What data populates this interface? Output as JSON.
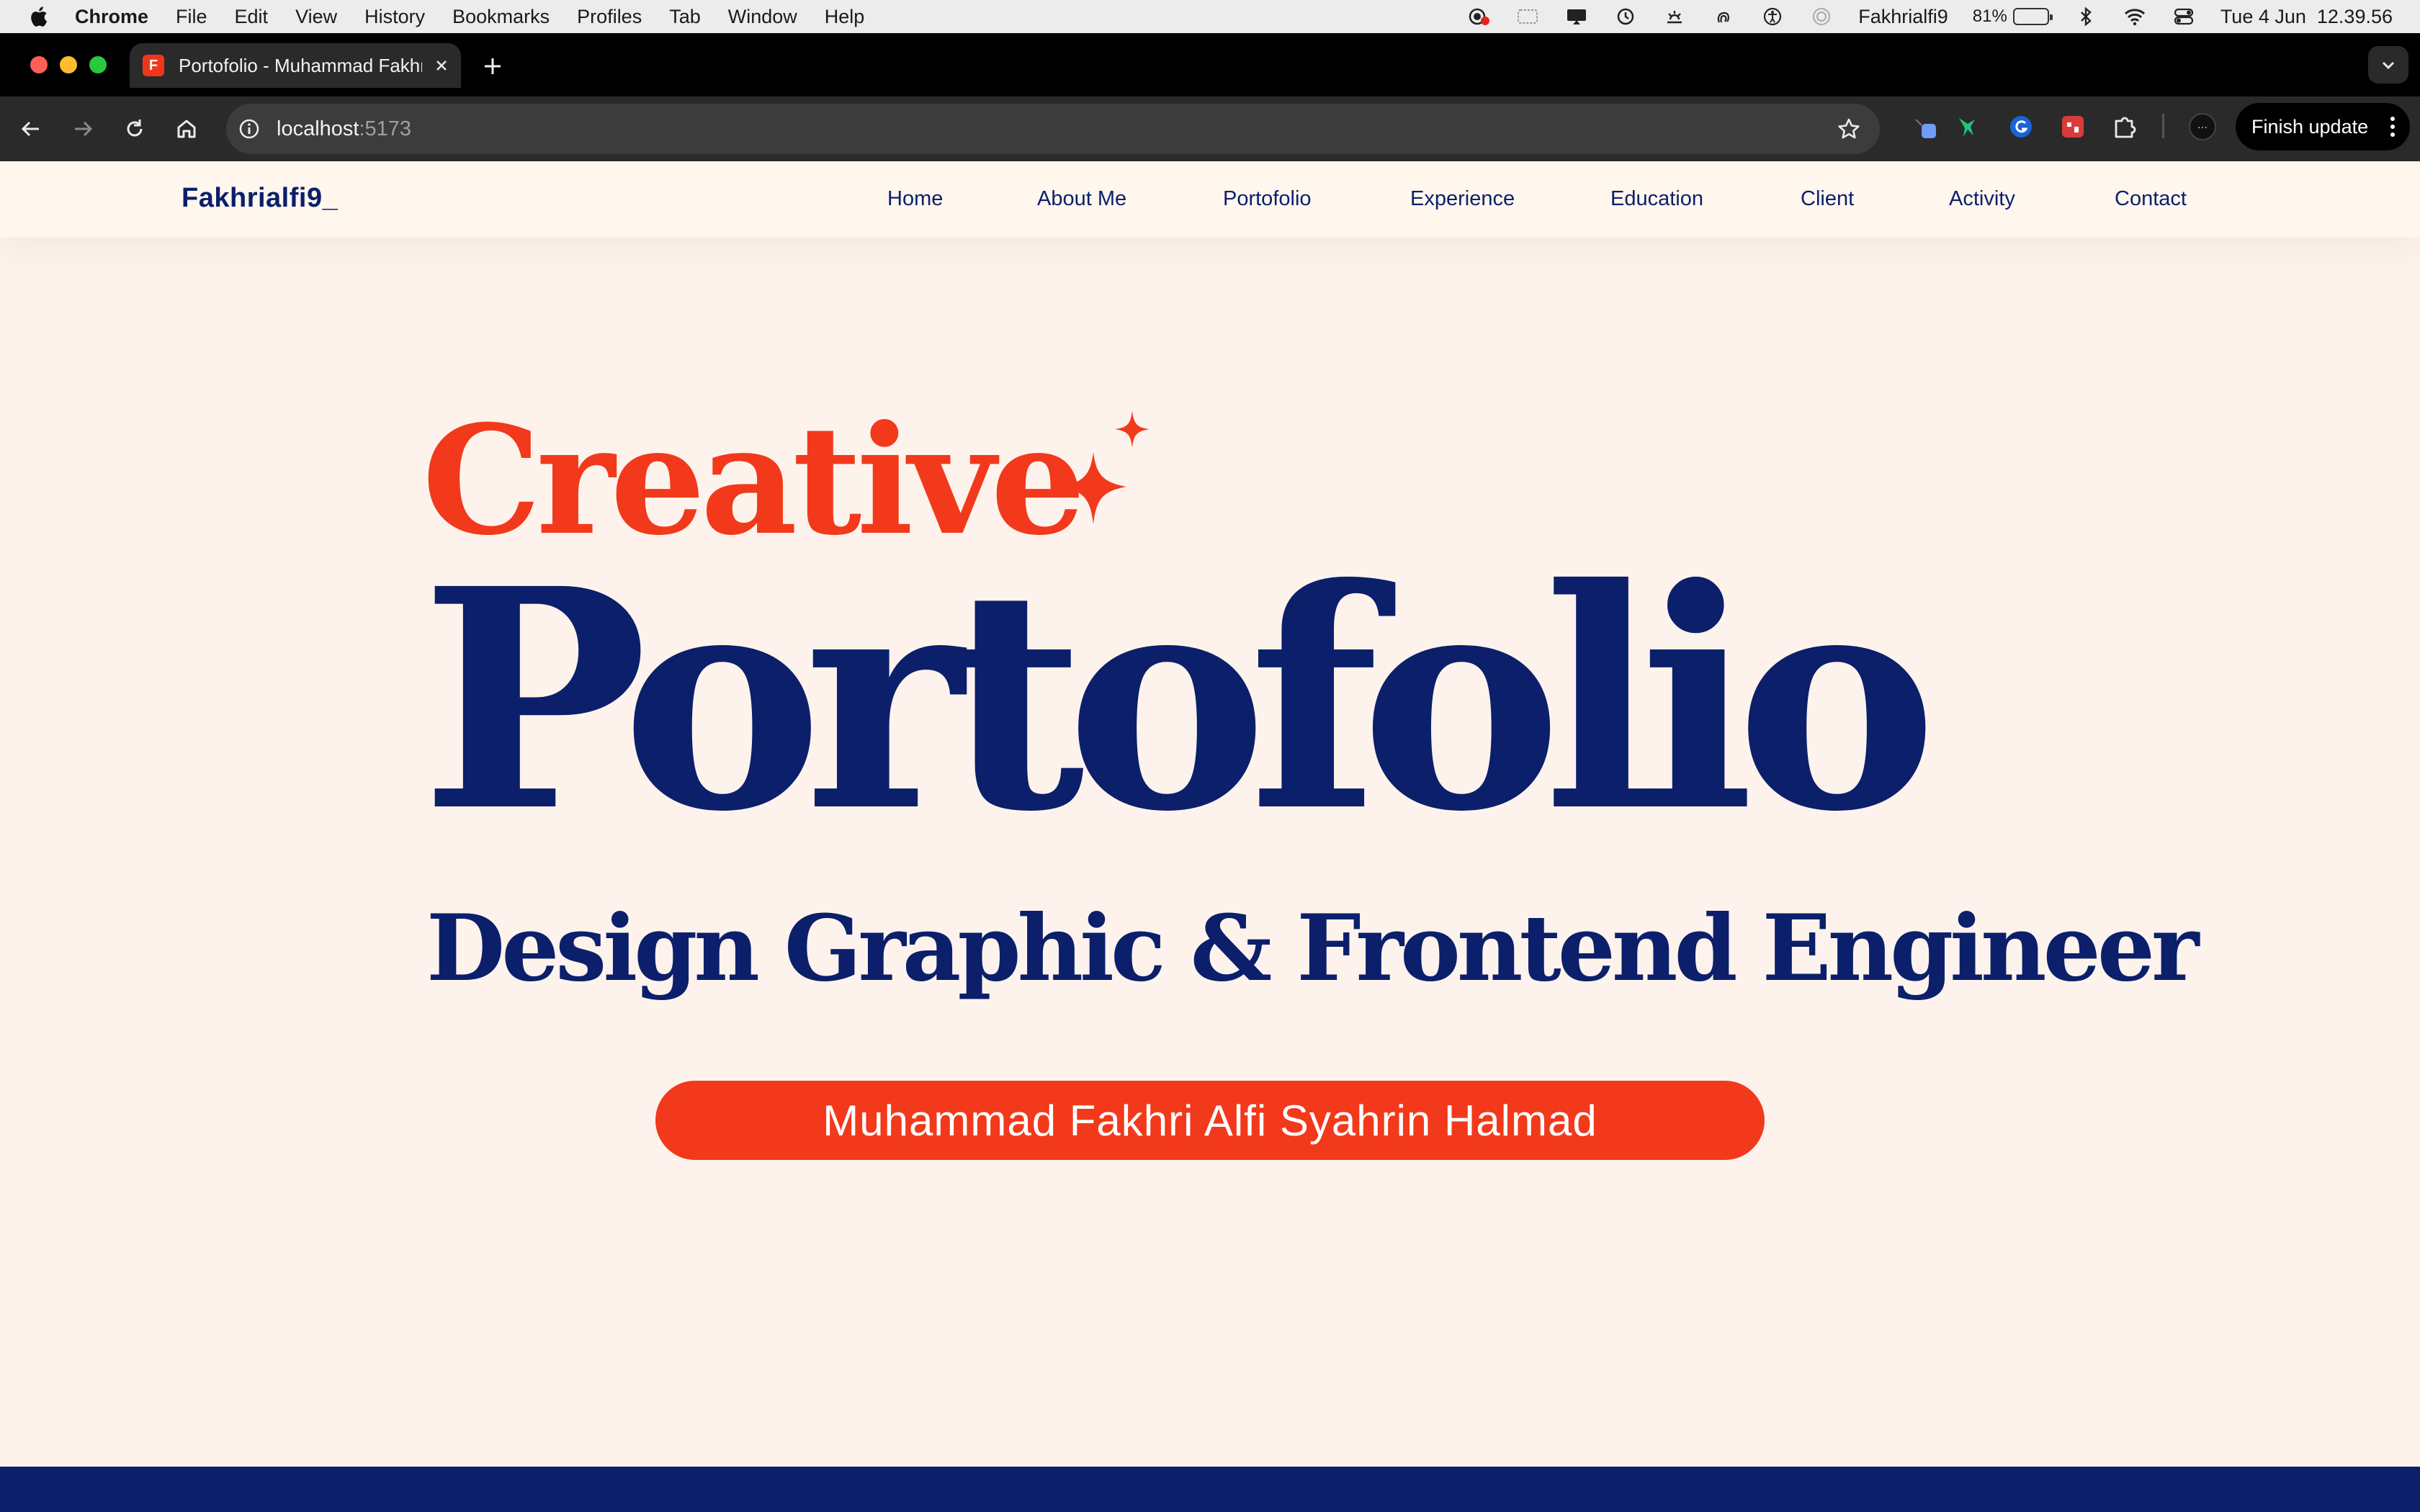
{
  "menubar": {
    "app_name": "Chrome",
    "items": [
      "File",
      "Edit",
      "View",
      "History",
      "Bookmarks",
      "Profiles",
      "Tab",
      "Window",
      "Help"
    ],
    "user": "Fakhrialfi9",
    "battery_percent": "81%",
    "battery_level": 0.81,
    "datetime": "Tue 4 Jun  12.39.56",
    "status_icons": [
      "screen-record-icon",
      "sidebar-icon",
      "display-icon",
      "time-machine-icon",
      "brightness-icon",
      "fingerprint-icon",
      "accessibility-icon",
      "airdrop-icon",
      "bluetooth-icon",
      "wifi-icon",
      "control-center-icon"
    ]
  },
  "browser": {
    "tab_title": "Portofolio - Muhammad Fakhri Alfi Syahrin Halmad",
    "favicon_letter": "F",
    "url_host": "localhost",
    "url_port": ":5173",
    "finish_update_label": "Finish update",
    "extensions": [
      "profile-extension-icon",
      "hummingbird-extension-icon",
      "grammarly-extension-icon",
      "red-extension-icon",
      "puzzle-extensions-icon"
    ]
  },
  "site": {
    "brand": "Fakhrialfi9_",
    "nav": [
      "Home",
      "About Me",
      "Portofolio",
      "Experience",
      "Education",
      "Client",
      "Activity",
      "Contact"
    ],
    "hero": {
      "headline_accent": "Creative",
      "headline_main": "Portofolio",
      "subtitle": "Design Graphic & Frontend Engineer",
      "name": "Muhammad Fakhri Alfi Syahrin Halmad"
    },
    "colors": {
      "accent": "#f2391b",
      "primary": "#0b1f6b",
      "background": "#fdf3ec"
    }
  }
}
